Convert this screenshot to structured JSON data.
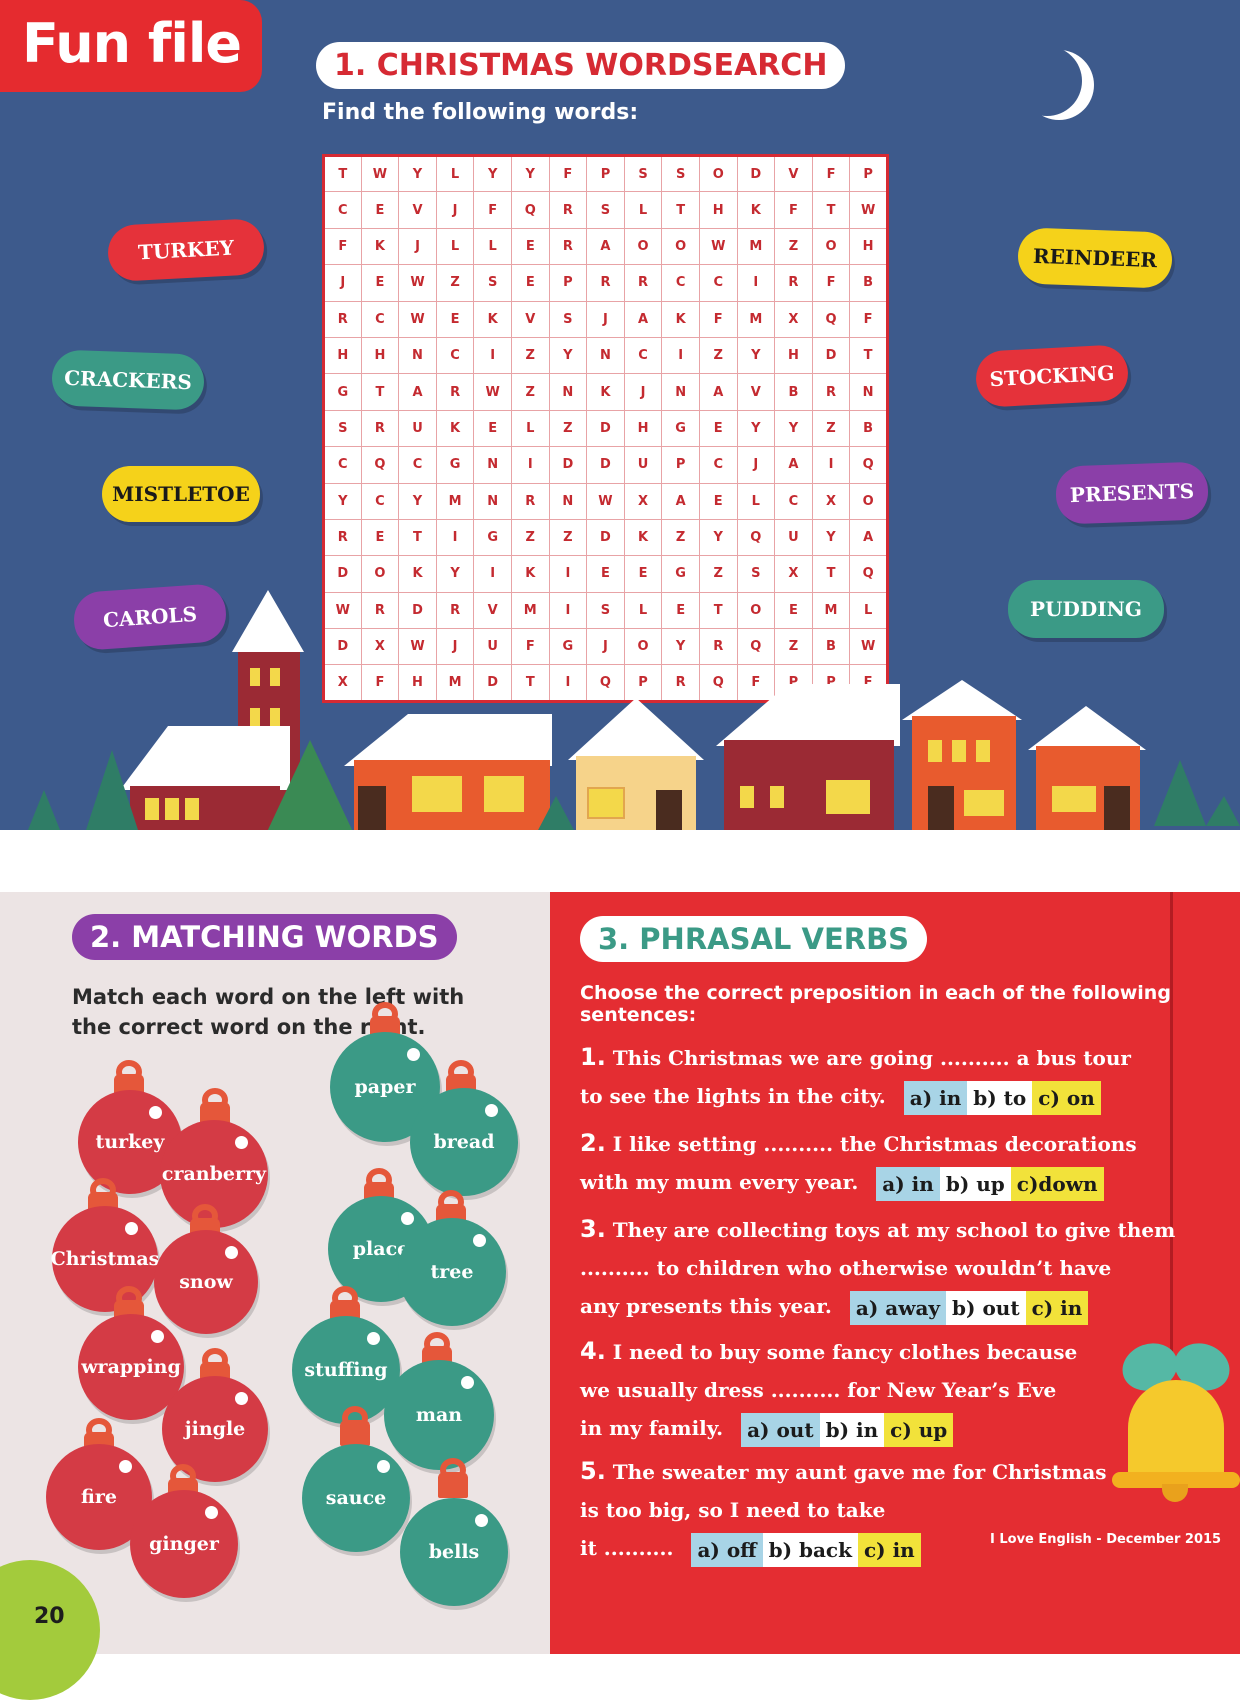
{
  "header": {
    "section_label": "Fun file"
  },
  "wordsearch": {
    "title": "1. CHRISTMAS WORDSEARCH",
    "instruction": "Find the following words:",
    "grid": [
      [
        "T",
        "W",
        "Y",
        "L",
        "Y",
        "Y",
        "F",
        "P",
        "S",
        "S",
        "O",
        "D",
        "V",
        "F",
        "P"
      ],
      [
        "C",
        "E",
        "V",
        "J",
        "F",
        "Q",
        "R",
        "S",
        "L",
        "T",
        "H",
        "K",
        "F",
        "T",
        "W"
      ],
      [
        "F",
        "K",
        "J",
        "L",
        "L",
        "E",
        "R",
        "A",
        "O",
        "O",
        "W",
        "M",
        "Z",
        "O",
        "H"
      ],
      [
        "J",
        "E",
        "W",
        "Z",
        "S",
        "E",
        "P",
        "R",
        "R",
        "C",
        "C",
        "I",
        "R",
        "F",
        "B"
      ],
      [
        "R",
        "C",
        "W",
        "E",
        "K",
        "V",
        "S",
        "J",
        "A",
        "K",
        "F",
        "M",
        "X",
        "Q",
        "F"
      ],
      [
        "H",
        "H",
        "N",
        "C",
        "I",
        "Z",
        "Y",
        "N",
        "C",
        "I",
        "Z",
        "Y",
        "H",
        "D",
        "T"
      ],
      [
        "G",
        "T",
        "A",
        "R",
        "W",
        "Z",
        "N",
        "K",
        "J",
        "N",
        "A",
        "V",
        "B",
        "R",
        "N"
      ],
      [
        "S",
        "R",
        "U",
        "K",
        "E",
        "L",
        "Z",
        "D",
        "H",
        "G",
        "E",
        "Y",
        "Y",
        "Z",
        "B"
      ],
      [
        "C",
        "Q",
        "C",
        "G",
        "N",
        "I",
        "D",
        "D",
        "U",
        "P",
        "C",
        "J",
        "A",
        "I",
        "Q"
      ],
      [
        "Y",
        "C",
        "Y",
        "M",
        "N",
        "R",
        "N",
        "W",
        "X",
        "A",
        "E",
        "L",
        "C",
        "X",
        "O"
      ],
      [
        "R",
        "E",
        "T",
        "I",
        "G",
        "Z",
        "Z",
        "D",
        "K",
        "Z",
        "Y",
        "Q",
        "U",
        "Y",
        "A"
      ],
      [
        "D",
        "O",
        "K",
        "Y",
        "I",
        "K",
        "I",
        "E",
        "E",
        "G",
        "Z",
        "S",
        "X",
        "T",
        "Q"
      ],
      [
        "W",
        "R",
        "D",
        "R",
        "V",
        "M",
        "I",
        "S",
        "L",
        "E",
        "T",
        "O",
        "E",
        "M",
        "L"
      ],
      [
        "D",
        "X",
        "W",
        "J",
        "U",
        "F",
        "G",
        "J",
        "O",
        "Y",
        "R",
        "Q",
        "Z",
        "B",
        "W"
      ],
      [
        "X",
        "F",
        "H",
        "M",
        "D",
        "T",
        "I",
        "Q",
        "P",
        "R",
        "Q",
        "F",
        "P",
        "P",
        "E"
      ]
    ],
    "words_left": [
      {
        "label": "TURKEY",
        "color": "#e5323a"
      },
      {
        "label": "CRACKERS",
        "color": "#3b9a86"
      },
      {
        "label": "MISTLETOE",
        "color": "#f5d21a"
      },
      {
        "label": "CAROLS",
        "color": "#8b3fa8"
      }
    ],
    "words_right": [
      {
        "label": "REINDEER",
        "color": "#f5d21a"
      },
      {
        "label": "STOCKING",
        "color": "#e5323a"
      },
      {
        "label": "PRESENTS",
        "color": "#8b3fa8"
      },
      {
        "label": "PUDDING",
        "color": "#3b9a86"
      }
    ]
  },
  "matching": {
    "title": "2. MATCHING WORDS",
    "instruction": "Match each word on the left with the correct word on the right.",
    "left_words": [
      "turkey",
      "cranberry",
      "Christmas",
      "snow",
      "wrapping",
      "jingle",
      "fire",
      "ginger"
    ],
    "right_words": [
      "paper",
      "bread",
      "place",
      "tree",
      "stuffing",
      "man",
      "sauce",
      "bells"
    ]
  },
  "phrasal": {
    "title": "3. PHRASAL VERBS",
    "instruction": "Choose the correct preposition in each of the following sentences:",
    "questions": [
      {
        "num": "1.",
        "lines": [
          "This Christmas we are going .......... a bus tour",
          "to see the lights in the city."
        ],
        "a": "a) in",
        "b": "b) to",
        "c": "c) on"
      },
      {
        "num": "2.",
        "lines": [
          "I like setting .......... the Christmas decorations",
          "with my mum every year."
        ],
        "a": "a) in",
        "b": "b) up",
        "c": "c)down"
      },
      {
        "num": "3.",
        "lines": [
          "They are collecting toys at my school to give them",
          ".......... to children who otherwise wouldn’t have",
          "any presents this year."
        ],
        "a": "a) away",
        "b": "b) out",
        "c": "c) in"
      },
      {
        "num": "4.",
        "lines": [
          "I need to buy some fancy clothes because",
          "we usually dress .......... for New Year’s Eve",
          "in my family."
        ],
        "a": "a) out",
        "b": "b) in",
        "c": "c) up"
      },
      {
        "num": "5.",
        "lines": [
          "The sweater my aunt gave me for Christmas",
          "is too big, so I need to take",
          "it .........."
        ],
        "a": "a) off",
        "b": "b) back",
        "c": "c) in"
      }
    ]
  },
  "footer": {
    "page_number": "20",
    "publication": "I Love English - December 2015"
  },
  "colors": {
    "sky": "#3d5a8c",
    "red": "#e42d32",
    "green": "#3b9a86",
    "purple": "#8b3fa8",
    "yellow": "#f5d21a"
  }
}
